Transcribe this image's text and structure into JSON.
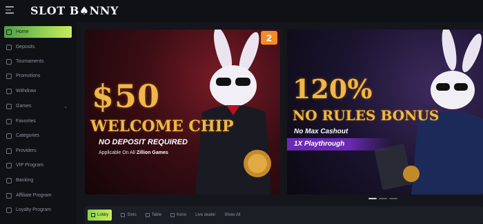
{
  "app": {
    "logo": "SLOT B♠NNY"
  },
  "sidebar": {
    "items": [
      {
        "label": "Home",
        "icon": "home-icon",
        "active": true
      },
      {
        "label": "Deposits",
        "icon": "wallet-icon"
      },
      {
        "label": "Tournaments",
        "icon": "trophy-icon"
      },
      {
        "label": "Promotions",
        "icon": "gift-icon"
      },
      {
        "label": "Withdraw",
        "icon": "withdraw-icon"
      },
      {
        "label": "Games",
        "icon": "dice-icon",
        "chevron": "⌄"
      },
      {
        "label": "Favorites",
        "icon": "star-icon"
      },
      {
        "label": "Categories",
        "icon": "grid-icon"
      },
      {
        "label": "Providers",
        "icon": "provider-icon"
      },
      {
        "label": "VIP Program",
        "icon": "crown-icon"
      },
      {
        "label": "Banking",
        "icon": "bank-icon"
      },
      {
        "label": "Affiliate Program",
        "icon": "affiliate-icon"
      },
      {
        "label": "Loyalty Program",
        "icon": "heart-icon"
      }
    ]
  },
  "banners": [
    {
      "badge": "2",
      "headline": "$50",
      "headline2": "WELCOME CHIP",
      "subtitle": "NO DEPOSIT REQUIRED",
      "note_prefix": "Applicable On All ",
      "note_bold": "Zillion Games"
    },
    {
      "headline": "120%",
      "headline2": "NO RULES BONUS",
      "subtitle": "No Max Cashout",
      "playthrough": "1X Playthrough"
    }
  ],
  "filters": [
    {
      "label": "Lobby",
      "icon": "lobby-icon",
      "active": true
    },
    {
      "label": "Slots",
      "icon": "slots-icon"
    },
    {
      "label": "Table",
      "icon": "table-icon"
    },
    {
      "label": "Keno",
      "icon": "keno-icon"
    },
    {
      "label": "Live dealer",
      "icon": ""
    },
    {
      "label": "Show All",
      "icon": ""
    }
  ],
  "colors": {
    "accent": "#8ecf52",
    "gold": "#f0b64a",
    "purple": "#6a2ab3",
    "background": "#0f1115"
  }
}
